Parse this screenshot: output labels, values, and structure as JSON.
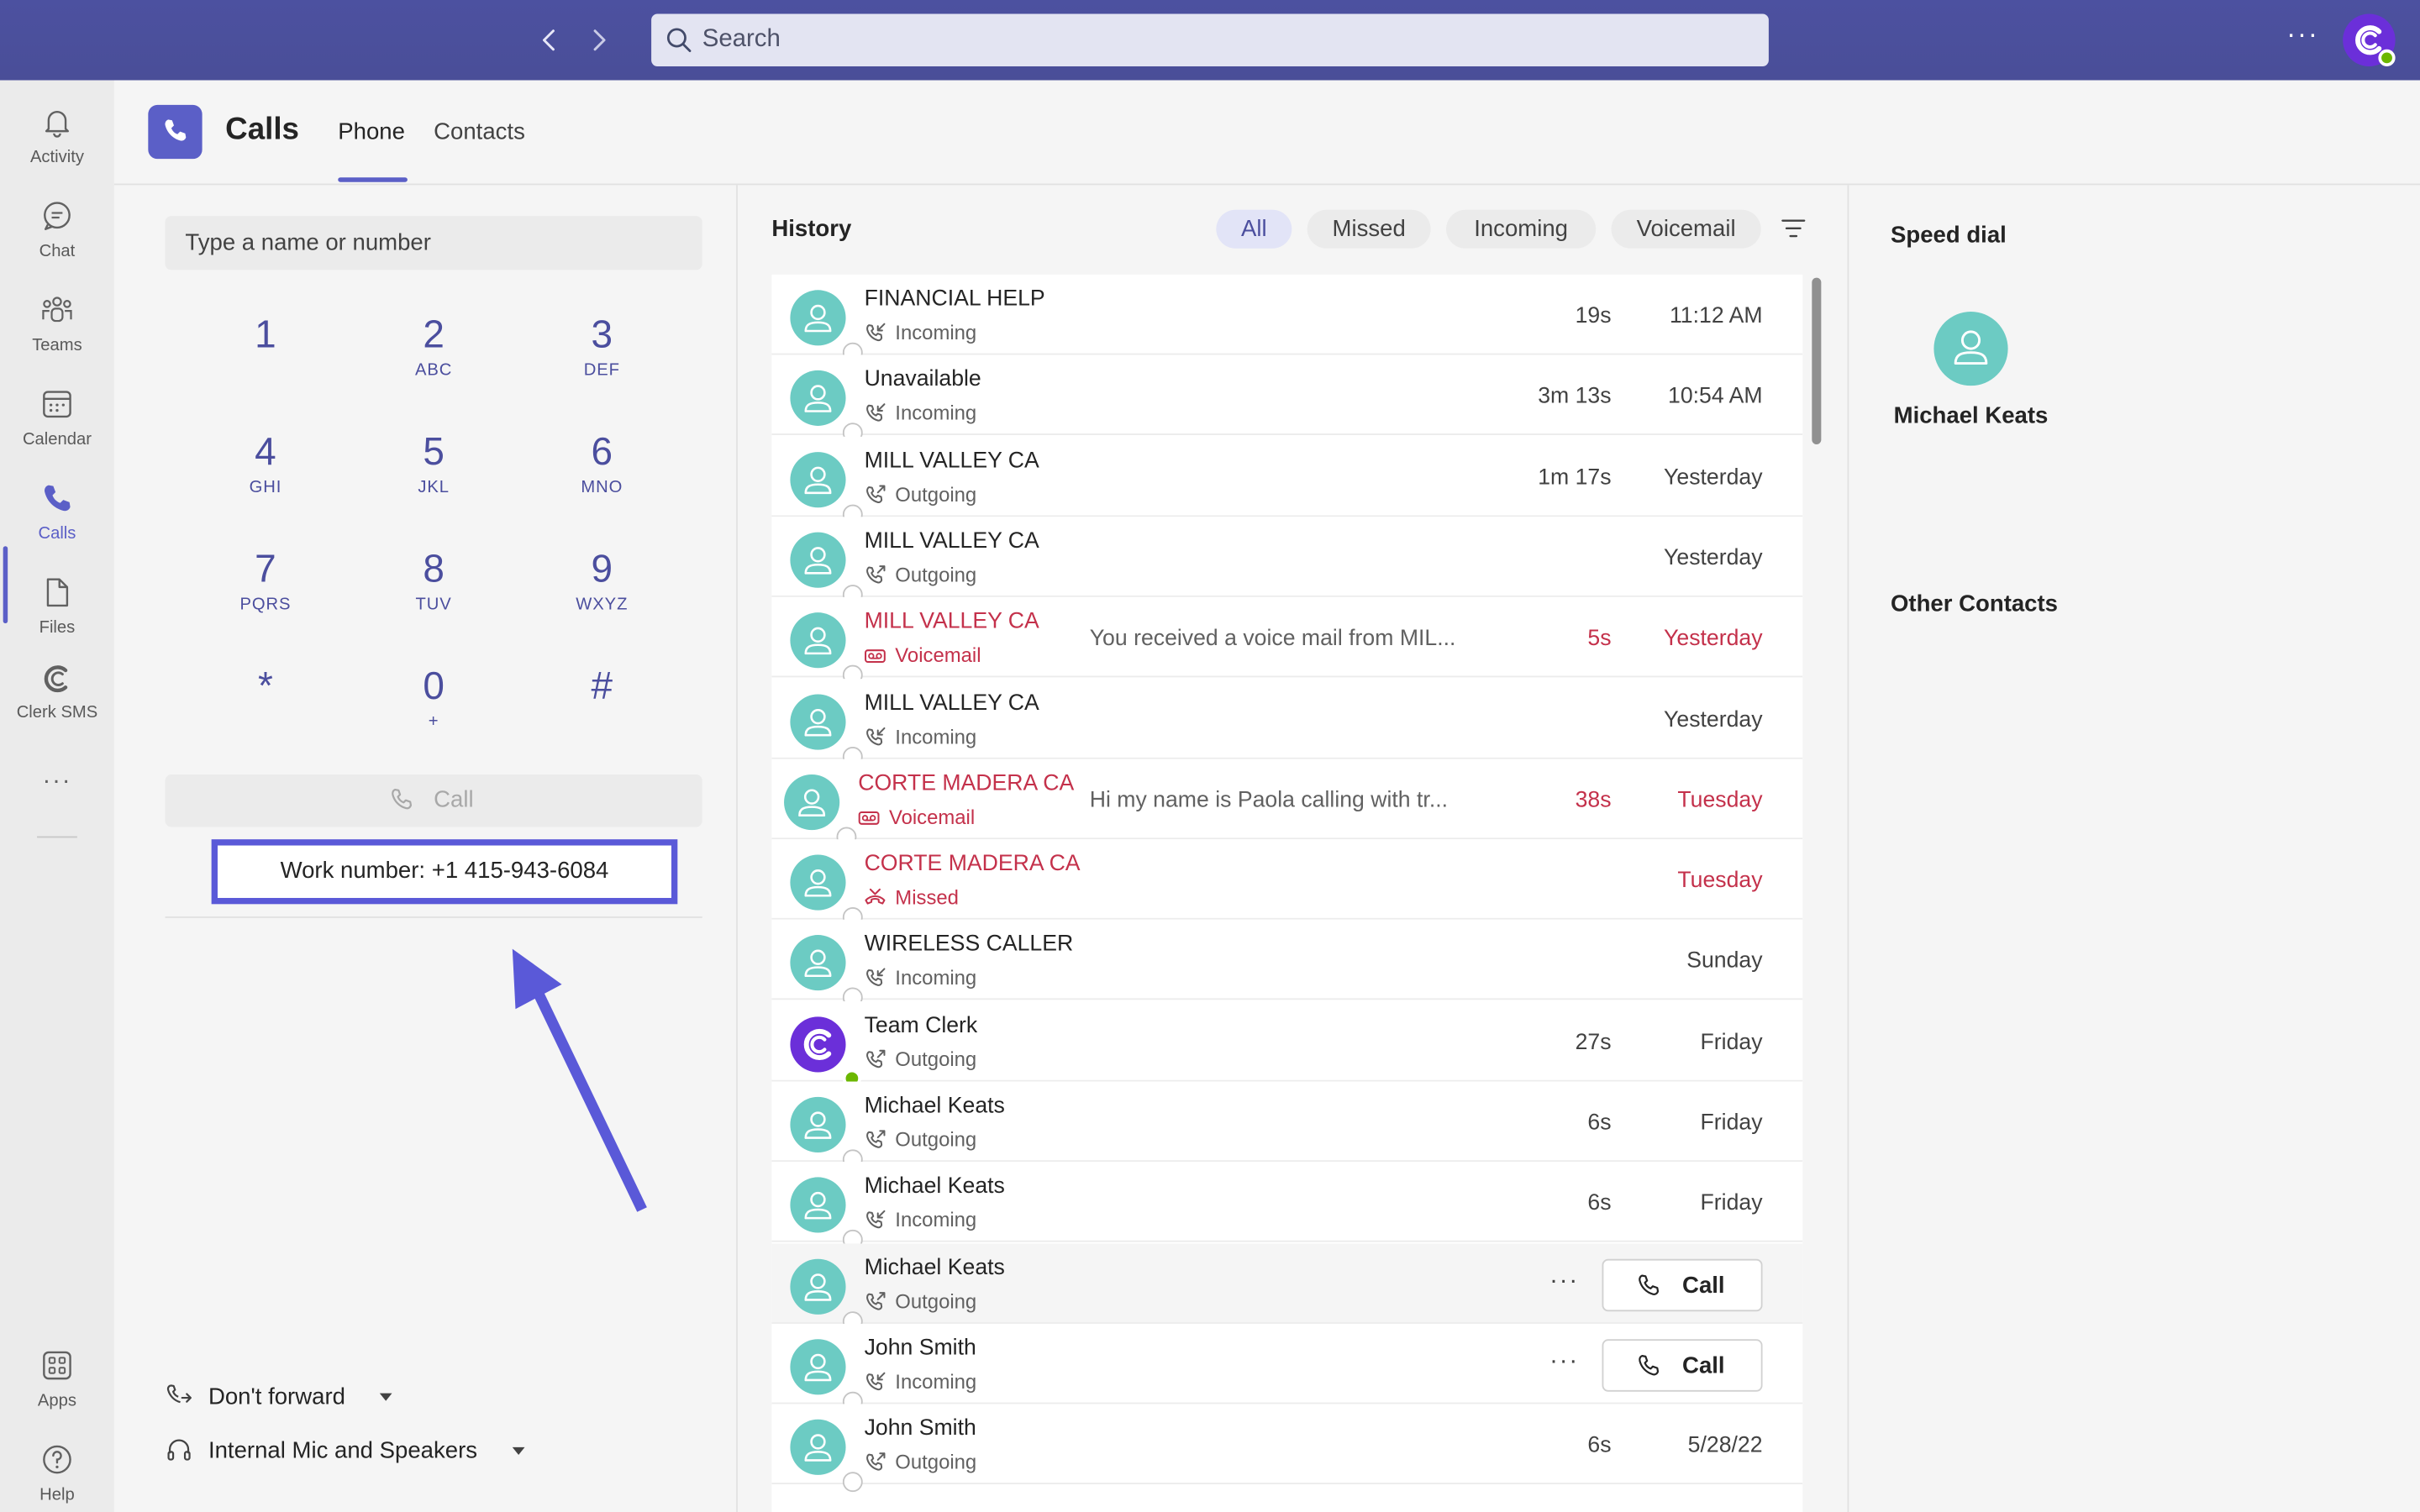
{
  "topbar": {
    "search_placeholder": "Search",
    "more_label": "···"
  },
  "rail": {
    "items": [
      {
        "label": "Activity",
        "icon": "bell-icon"
      },
      {
        "label": "Chat",
        "icon": "chat-icon"
      },
      {
        "label": "Teams",
        "icon": "teams-icon"
      },
      {
        "label": "Calendar",
        "icon": "calendar-icon"
      },
      {
        "label": "Calls",
        "icon": "phone-icon",
        "active": true
      },
      {
        "label": "Files",
        "icon": "file-icon"
      },
      {
        "label": "Clerk SMS",
        "icon": "clerk-icon"
      }
    ],
    "more": "···",
    "apps_label": "Apps",
    "help_label": "Help"
  },
  "header": {
    "title": "Calls",
    "tabs": [
      {
        "label": "Phone",
        "active": true
      },
      {
        "label": "Contacts",
        "active": false
      }
    ]
  },
  "dialer": {
    "input_placeholder": "Type a name or number",
    "keys": [
      {
        "digit": "1",
        "letters": ""
      },
      {
        "digit": "2",
        "letters": "ABC"
      },
      {
        "digit": "3",
        "letters": "DEF"
      },
      {
        "digit": "4",
        "letters": "GHI"
      },
      {
        "digit": "5",
        "letters": "JKL"
      },
      {
        "digit": "6",
        "letters": "MNO"
      },
      {
        "digit": "7",
        "letters": "PQRS"
      },
      {
        "digit": "8",
        "letters": "TUV"
      },
      {
        "digit": "9",
        "letters": "WXYZ"
      },
      {
        "digit": "*",
        "letters": ""
      },
      {
        "digit": "0",
        "letters": "+"
      },
      {
        "digit": "#",
        "letters": ""
      }
    ],
    "call_label": "Call",
    "work_number": "Work number: +1 415-943-6084",
    "forward_label": "Don't forward",
    "audio_label": "Internal Mic and Speakers"
  },
  "history": {
    "title": "History",
    "filters": [
      {
        "label": "All",
        "active": true
      },
      {
        "label": "Missed",
        "active": false
      },
      {
        "label": "Incoming",
        "active": false
      },
      {
        "label": "Voicemail",
        "active": false
      }
    ],
    "rows": [
      {
        "name": "FINANCIAL HELP",
        "type": "Incoming",
        "preview": "",
        "duration": "19s",
        "when": "11:12 AM",
        "red": false
      },
      {
        "name": "Unavailable",
        "type": "Incoming",
        "preview": "",
        "duration": "3m 13s",
        "when": "10:54 AM",
        "red": false
      },
      {
        "name": "MILL VALLEY CA",
        "type": "Outgoing",
        "preview": "",
        "duration": "1m 17s",
        "when": "Yesterday",
        "red": false
      },
      {
        "name": "MILL VALLEY CA",
        "type": "Outgoing",
        "preview": "",
        "duration": "",
        "when": "Yesterday",
        "red": false
      },
      {
        "name": "MILL VALLEY CA",
        "type": "Voicemail",
        "preview": "You received a voice mail from MIL...",
        "duration": "5s",
        "when": "Yesterday",
        "red": true
      },
      {
        "name": "MILL VALLEY CA",
        "type": "Incoming",
        "preview": "",
        "duration": "",
        "when": "Yesterday",
        "red": false
      },
      {
        "name": "CORTE MADERA CA",
        "type": "Voicemail",
        "preview": "Hi my name is Paola calling with tr...",
        "duration": "38s",
        "when": "Tuesday",
        "red": true
      },
      {
        "name": "CORTE MADERA CA",
        "type": "Missed",
        "preview": "",
        "duration": "",
        "when": "Tuesday",
        "red": true
      },
      {
        "name": "WIRELESS CALLER",
        "type": "Incoming",
        "preview": "",
        "duration": "",
        "when": "Sunday",
        "red": false
      },
      {
        "name": "Team Clerk",
        "type": "Outgoing",
        "preview": "",
        "duration": "27s",
        "when": "Friday",
        "red": false,
        "clerk": true
      },
      {
        "name": "Michael Keats",
        "type": "Outgoing",
        "preview": "",
        "duration": "6s",
        "when": "Friday",
        "red": false
      },
      {
        "name": "Michael Keats",
        "type": "Incoming",
        "preview": "",
        "duration": "6s",
        "when": "Friday",
        "red": false
      },
      {
        "name": "Michael Keats",
        "type": "Outgoing",
        "preview": "",
        "duration": "",
        "when": "",
        "red": false,
        "actions": true,
        "hover": true
      },
      {
        "name": "John Smith",
        "type": "Incoming",
        "preview": "",
        "duration": "",
        "when": "",
        "red": false,
        "actions": true
      },
      {
        "name": "John Smith",
        "type": "Outgoing",
        "preview": "",
        "duration": "6s",
        "when": "5/28/22",
        "red": false
      }
    ],
    "row_call_label": "Call",
    "row_more_label": "···"
  },
  "speed_dial": {
    "title": "Speed dial",
    "contacts": [
      {
        "name": "Michael Keats"
      }
    ],
    "other_title": "Other Contacts"
  },
  "colors": {
    "accent": "#5b5fc7",
    "topbar": "#4b4f9c",
    "avatar": "#6ccbc3",
    "missed_red": "#c4314b",
    "annotation": "#5a59d8"
  }
}
